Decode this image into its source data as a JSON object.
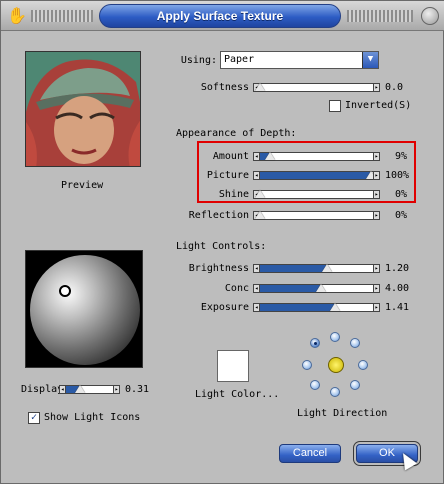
{
  "window": {
    "title": "Apply Surface Texture"
  },
  "preview": {
    "label": "Preview"
  },
  "using": {
    "label": "Using:",
    "value": "Paper"
  },
  "softness": {
    "label": "Softness",
    "value": "0.0",
    "level": 0.0
  },
  "inverted": {
    "label": "Inverted(S)",
    "checked": false
  },
  "depth": {
    "heading": "Appearance of Depth:",
    "amount": {
      "label": "Amount",
      "value": "9%",
      "level": 0.09
    },
    "picture": {
      "label": "Picture",
      "value": "100%",
      "level": 1.0
    },
    "shine": {
      "label": "Shine",
      "value": "0%",
      "level": 0.0
    },
    "reflection": {
      "label": "Reflection",
      "value": "0%",
      "level": 0.0
    }
  },
  "light": {
    "heading": "Light Controls:",
    "brightness": {
      "label": "Brightness",
      "value": "1.20",
      "level": 0.6
    },
    "conc": {
      "label": "Conc",
      "value": "4.00",
      "level": 0.55
    },
    "exposure": {
      "label": "Exposure",
      "value": "1.41",
      "level": 0.68
    }
  },
  "display": {
    "label": "Display",
    "value": "0.31",
    "level": 0.31
  },
  "show_light_icons": {
    "label": "Show Light Icons",
    "checked": true
  },
  "light_color": {
    "label": "Light Color...",
    "color": "#ffffff"
  },
  "light_direction": {
    "label": "Light Direction"
  },
  "buttons": {
    "cancel": "Cancel",
    "ok": "OK"
  },
  "colors": {
    "accent": "#2a5aa6",
    "highlight_box": "#e00000"
  }
}
